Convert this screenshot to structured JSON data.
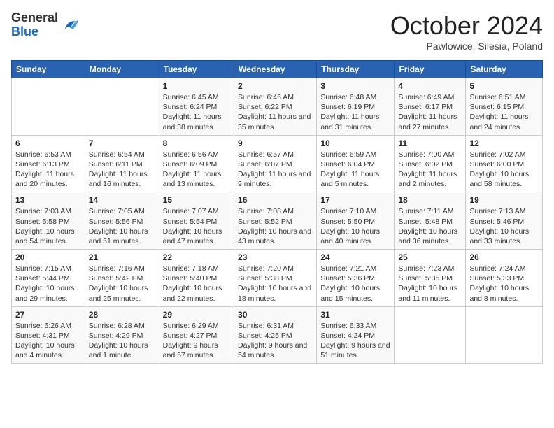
{
  "header": {
    "logo_general": "General",
    "logo_blue": "Blue",
    "title": "October 2024",
    "location": "Pawlowice, Silesia, Poland"
  },
  "days_of_week": [
    "Sunday",
    "Monday",
    "Tuesday",
    "Wednesday",
    "Thursday",
    "Friday",
    "Saturday"
  ],
  "weeks": [
    [
      {
        "num": "",
        "info": ""
      },
      {
        "num": "",
        "info": ""
      },
      {
        "num": "1",
        "info": "Sunrise: 6:45 AM\nSunset: 6:24 PM\nDaylight: 11 hours and 38 minutes."
      },
      {
        "num": "2",
        "info": "Sunrise: 6:46 AM\nSunset: 6:22 PM\nDaylight: 11 hours and 35 minutes."
      },
      {
        "num": "3",
        "info": "Sunrise: 6:48 AM\nSunset: 6:19 PM\nDaylight: 11 hours and 31 minutes."
      },
      {
        "num": "4",
        "info": "Sunrise: 6:49 AM\nSunset: 6:17 PM\nDaylight: 11 hours and 27 minutes."
      },
      {
        "num": "5",
        "info": "Sunrise: 6:51 AM\nSunset: 6:15 PM\nDaylight: 11 hours and 24 minutes."
      }
    ],
    [
      {
        "num": "6",
        "info": "Sunrise: 6:53 AM\nSunset: 6:13 PM\nDaylight: 11 hours and 20 minutes."
      },
      {
        "num": "7",
        "info": "Sunrise: 6:54 AM\nSunset: 6:11 PM\nDaylight: 11 hours and 16 minutes."
      },
      {
        "num": "8",
        "info": "Sunrise: 6:56 AM\nSunset: 6:09 PM\nDaylight: 11 hours and 13 minutes."
      },
      {
        "num": "9",
        "info": "Sunrise: 6:57 AM\nSunset: 6:07 PM\nDaylight: 11 hours and 9 minutes."
      },
      {
        "num": "10",
        "info": "Sunrise: 6:59 AM\nSunset: 6:04 PM\nDaylight: 11 hours and 5 minutes."
      },
      {
        "num": "11",
        "info": "Sunrise: 7:00 AM\nSunset: 6:02 PM\nDaylight: 11 hours and 2 minutes."
      },
      {
        "num": "12",
        "info": "Sunrise: 7:02 AM\nSunset: 6:00 PM\nDaylight: 10 hours and 58 minutes."
      }
    ],
    [
      {
        "num": "13",
        "info": "Sunrise: 7:03 AM\nSunset: 5:58 PM\nDaylight: 10 hours and 54 minutes."
      },
      {
        "num": "14",
        "info": "Sunrise: 7:05 AM\nSunset: 5:56 PM\nDaylight: 10 hours and 51 minutes."
      },
      {
        "num": "15",
        "info": "Sunrise: 7:07 AM\nSunset: 5:54 PM\nDaylight: 10 hours and 47 minutes."
      },
      {
        "num": "16",
        "info": "Sunrise: 7:08 AM\nSunset: 5:52 PM\nDaylight: 10 hours and 43 minutes."
      },
      {
        "num": "17",
        "info": "Sunrise: 7:10 AM\nSunset: 5:50 PM\nDaylight: 10 hours and 40 minutes."
      },
      {
        "num": "18",
        "info": "Sunrise: 7:11 AM\nSunset: 5:48 PM\nDaylight: 10 hours and 36 minutes."
      },
      {
        "num": "19",
        "info": "Sunrise: 7:13 AM\nSunset: 5:46 PM\nDaylight: 10 hours and 33 minutes."
      }
    ],
    [
      {
        "num": "20",
        "info": "Sunrise: 7:15 AM\nSunset: 5:44 PM\nDaylight: 10 hours and 29 minutes."
      },
      {
        "num": "21",
        "info": "Sunrise: 7:16 AM\nSunset: 5:42 PM\nDaylight: 10 hours and 25 minutes."
      },
      {
        "num": "22",
        "info": "Sunrise: 7:18 AM\nSunset: 5:40 PM\nDaylight: 10 hours and 22 minutes."
      },
      {
        "num": "23",
        "info": "Sunrise: 7:20 AM\nSunset: 5:38 PM\nDaylight: 10 hours and 18 minutes."
      },
      {
        "num": "24",
        "info": "Sunrise: 7:21 AM\nSunset: 5:36 PM\nDaylight: 10 hours and 15 minutes."
      },
      {
        "num": "25",
        "info": "Sunrise: 7:23 AM\nSunset: 5:35 PM\nDaylight: 10 hours and 11 minutes."
      },
      {
        "num": "26",
        "info": "Sunrise: 7:24 AM\nSunset: 5:33 PM\nDaylight: 10 hours and 8 minutes."
      }
    ],
    [
      {
        "num": "27",
        "info": "Sunrise: 6:26 AM\nSunset: 4:31 PM\nDaylight: 10 hours and 4 minutes."
      },
      {
        "num": "28",
        "info": "Sunrise: 6:28 AM\nSunset: 4:29 PM\nDaylight: 10 hours and 1 minute."
      },
      {
        "num": "29",
        "info": "Sunrise: 6:29 AM\nSunset: 4:27 PM\nDaylight: 9 hours and 57 minutes."
      },
      {
        "num": "30",
        "info": "Sunrise: 6:31 AM\nSunset: 4:25 PM\nDaylight: 9 hours and 54 minutes."
      },
      {
        "num": "31",
        "info": "Sunrise: 6:33 AM\nSunset: 4:24 PM\nDaylight: 9 hours and 51 minutes."
      },
      {
        "num": "",
        "info": ""
      },
      {
        "num": "",
        "info": ""
      }
    ]
  ]
}
